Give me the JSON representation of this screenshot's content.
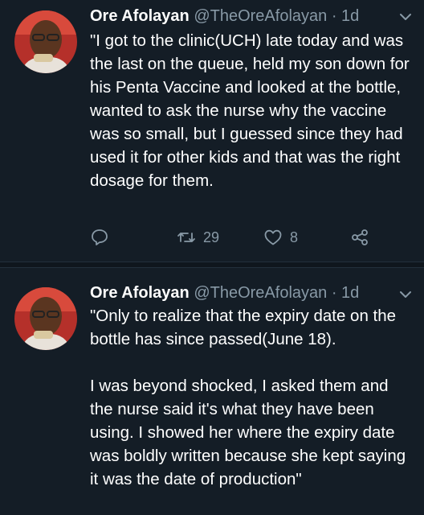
{
  "tweets": [
    {
      "author_name": "Ore Afolayan",
      "author_handle": "@TheOreAfolayan",
      "time": "· 1d",
      "text": "\"I got to the clinic(UCH) late today and was the last on the queue, held my son down for his Penta Vaccine and looked at the bottle, wanted to ask the nurse why the vaccine was so small, but I guessed since they had used it for other kids and that was the right dosage for them.",
      "retweets": "29",
      "likes": "8"
    },
    {
      "author_name": "Ore Afolayan",
      "author_handle": "@TheOreAfolayan",
      "time": "· 1d",
      "text": "\"Only to realize that the expiry date on the bottle has since passed(June 18).\n\nI was beyond shocked, I asked them and the nurse said it's what they have been using. I showed her where the expiry date was boldly written because she kept saying it was the date of production\""
    }
  ],
  "icons": {
    "reply": "reply-icon",
    "retweet": "retweet-icon",
    "like": "heart-icon",
    "share": "share-icon",
    "menu": "chevron-down-icon"
  },
  "colors": {
    "background": "#141d26",
    "text": "#ffffff",
    "secondary": "#8899a6"
  }
}
